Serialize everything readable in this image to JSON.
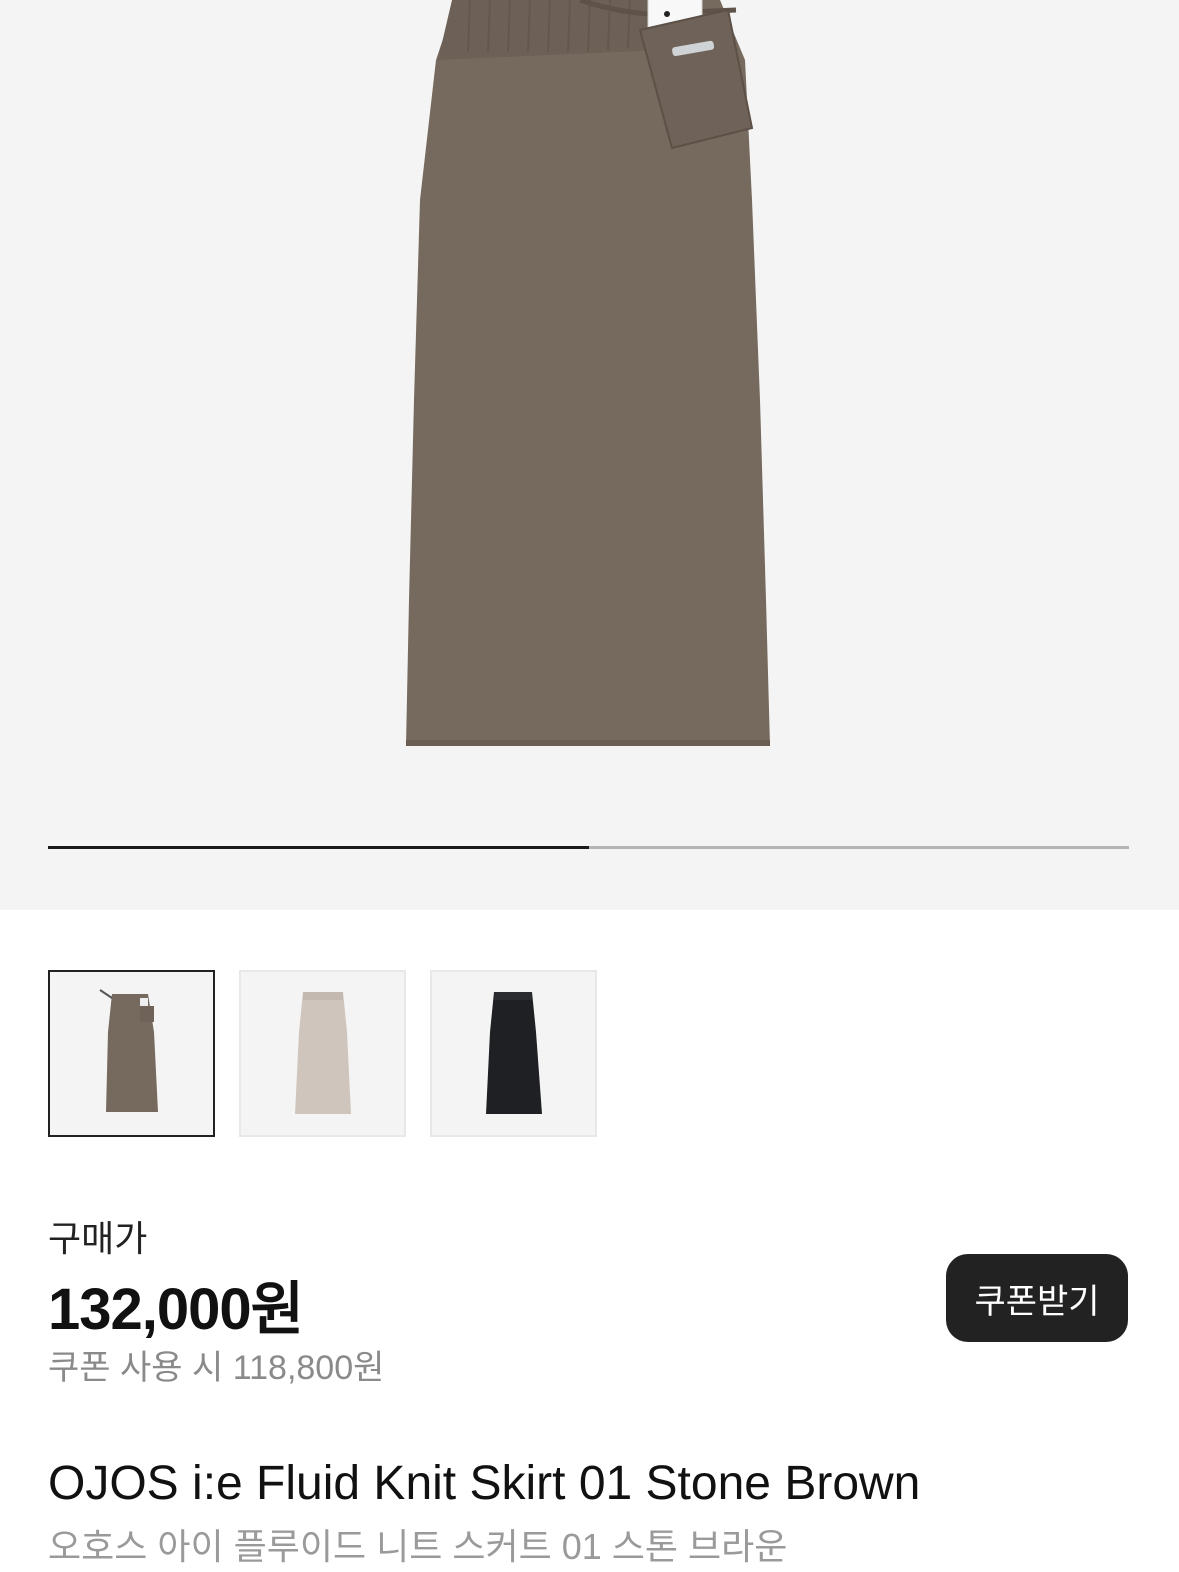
{
  "gallery": {
    "progress": 0.5,
    "main_image": "skirt-stone-brown",
    "thumbnails": [
      {
        "name": "stone-brown",
        "color": "#76695e",
        "selected": true
      },
      {
        "name": "beige",
        "color": "#cfc5bc",
        "selected": false
      },
      {
        "name": "black",
        "color": "#1f2023",
        "selected": false
      }
    ]
  },
  "price": {
    "label": "구매가",
    "amount": "132,000원",
    "coupon_text": "쿠폰 사용 시 118,800원",
    "coupon_button": "쿠폰받기"
  },
  "product": {
    "name_en": "OJOS i:e Fluid Knit Skirt 01 Stone Brown",
    "name_ko": "오호스 아이 플루이드 니트 스커트 01 스톤 브라운"
  },
  "colors": {
    "skirt": "#76695e",
    "background": "#f4f4f4",
    "button": "#222222"
  }
}
